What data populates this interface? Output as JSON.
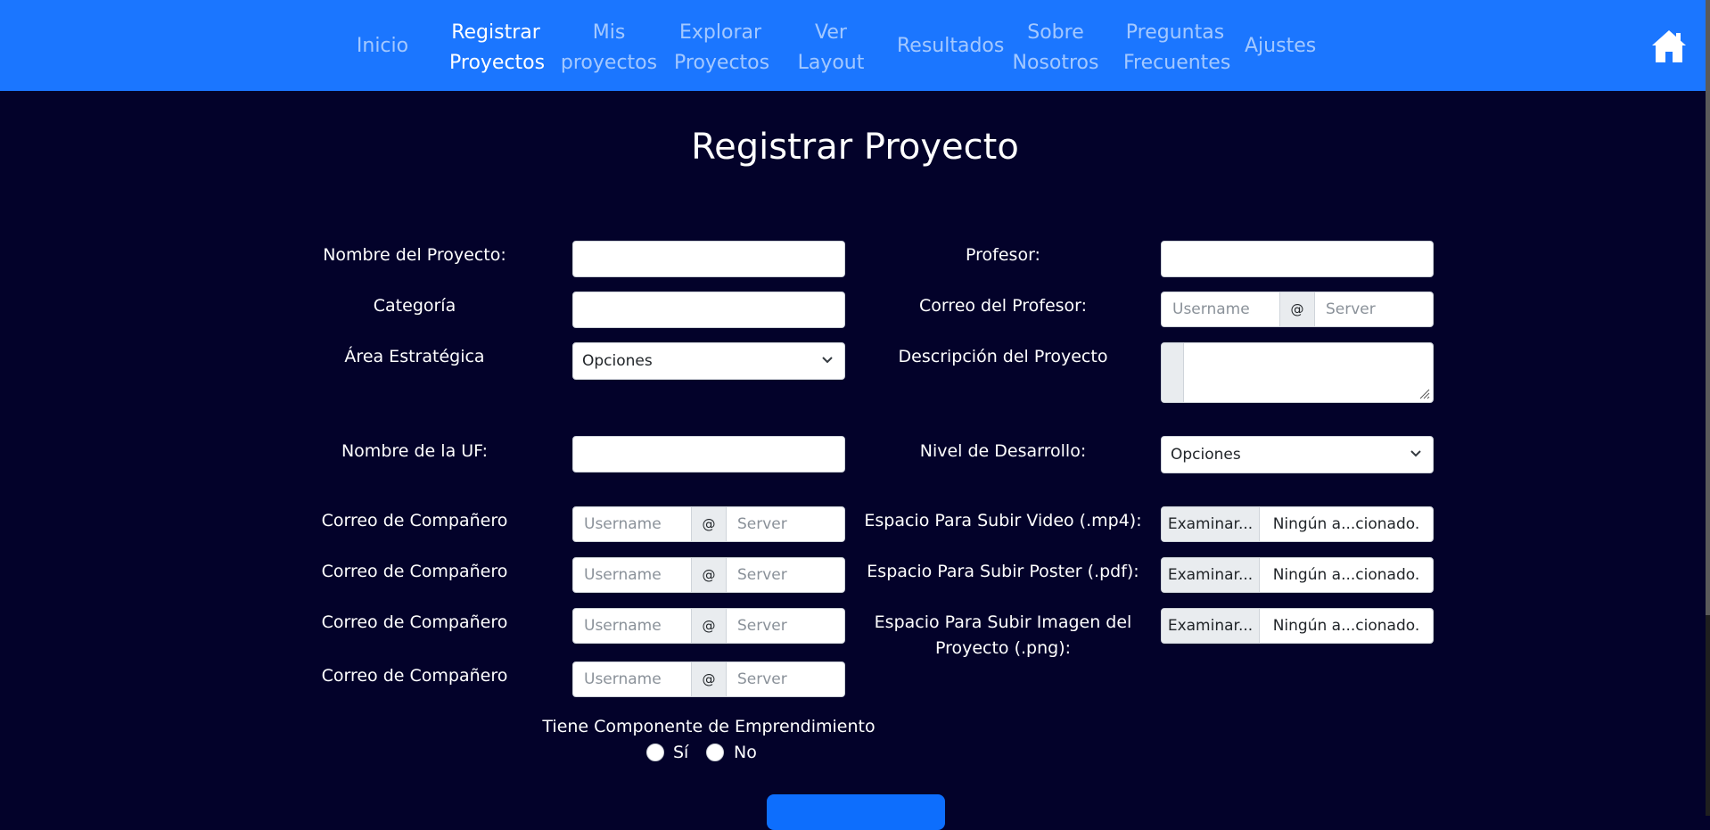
{
  "nav": {
    "items": [
      {
        "line1": "Inicio",
        "line2": ""
      },
      {
        "line1": "Registrar",
        "line2": "Proyectos"
      },
      {
        "line1": "Mis",
        "line2": "proyectos"
      },
      {
        "line1": "Explorar",
        "line2": "Proyectos"
      },
      {
        "line1": "Ver",
        "line2": "Layout"
      },
      {
        "line1": "Resultados",
        "line2": ""
      },
      {
        "line1": "Sobre",
        "line2": "Nosotros"
      },
      {
        "line1": "Preguntas",
        "line2": "Frecuentes"
      },
      {
        "line1": "Ajustes",
        "line2": ""
      }
    ],
    "active_index": 1,
    "home_icon": "home-icon",
    "colors": {
      "bar": "#1b76ff",
      "inactive_text": "rgba(255,255,255,0.6)",
      "active_text": "#ffffff"
    }
  },
  "page": {
    "title": "Registrar Proyecto",
    "background": "#03022a"
  },
  "form": {
    "project_name_label": "Nombre del Proyecto:",
    "category_label": "Categoría",
    "strategic_area_label": "Área Estratégica",
    "strategic_area_value": "Opciones",
    "uf_name_label": "Nombre de la UF:",
    "teammates": [
      {
        "label": "Correo de Compañero",
        "username_placeholder": "Username",
        "at": "@",
        "server_placeholder": "Server"
      },
      {
        "label": "Correo de Compañero",
        "username_placeholder": "Username",
        "at": "@",
        "server_placeholder": "Server"
      },
      {
        "label": "Correo de Compañero",
        "username_placeholder": "Username",
        "at": "@",
        "server_placeholder": "Server"
      },
      {
        "label": "Correo de Compañero",
        "username_placeholder": "Username",
        "at": "@",
        "server_placeholder": "Server"
      }
    ],
    "professor_label": "Profesor:",
    "professor_email_label": "Correo del Profesor:",
    "professor_email": {
      "username_placeholder": "Username",
      "at": "@",
      "server_placeholder": "Server"
    },
    "description_label": "Descripción del Proyecto",
    "dev_level_label": "Nivel de Desarrollo:",
    "dev_level_value": "Opciones",
    "uploads": [
      {
        "label_line1": "Espacio Para Subir Video (.mp4):",
        "label_line2": "",
        "button": "Examinar...",
        "file_name": "Ningún a...cionado."
      },
      {
        "label_line1": "Espacio Para Subir Poster (.pdf):",
        "label_line2": "",
        "button": "Examinar...",
        "file_name": "Ningún a...cionado."
      },
      {
        "label_line1": "Espacio Para Subir Imagen del",
        "label_line2": "Proyecto (.png):",
        "button": "Examinar...",
        "file_name": "Ningún a...cionado."
      }
    ],
    "entrepreneurship_label": "Tiene Componente de Emprendimiento",
    "yes_label": "Sí",
    "no_label": "No"
  }
}
